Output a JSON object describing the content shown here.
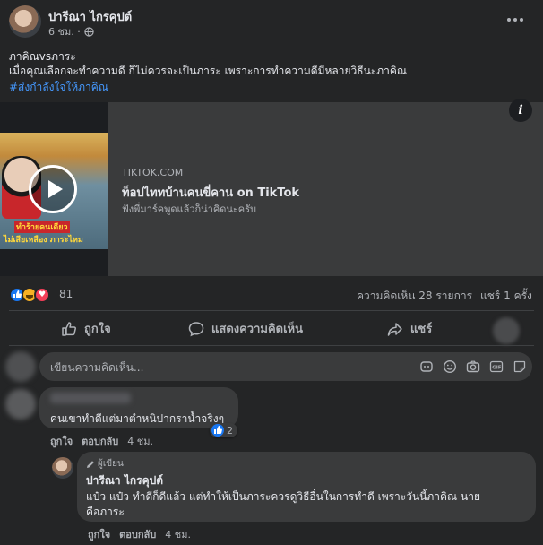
{
  "post": {
    "author": "ปารีณา ไกรคุปต์",
    "time": "6 ชม. ·",
    "text_line1": "ภาคิณvsภาระ",
    "text_line2": "เมื่อคุณเลือกจะทำความดี ก็ไม่ควรจะเป็นภาระ เพราะการทำความดีมีหลายวิธีนะภาคิณ",
    "hashtag": "#ส่งกำลังใจให้ภาคิณ",
    "more_icon": "more-horizontal-icon",
    "privacy_icon": "globe-icon"
  },
  "link_card": {
    "domain": "TIKTOK.COM",
    "title": "ท็อปไททบ้านคนขี่คาน on TikTok",
    "description": "ฟังพี่มาร์คพูดแล้วก็น่าคิดนะครับ",
    "thumb_caption1": "ทำร้ายคนเดียว",
    "thumb_caption2": "ไม่เสียเหลือง ภาระไหม",
    "info_icon": "info-icon",
    "play_icon": "play-icon"
  },
  "reactions": {
    "count": "81",
    "comments": "ความคิดเห็น 28 รายการ",
    "shares": "แชร์ 1 ครั้ง"
  },
  "actions": {
    "like": "ถูกใจ",
    "comment": "แสดงความคิดเห็น",
    "share": "แชร์"
  },
  "composer": {
    "placeholder": "เขียนความคิดเห็น..."
  },
  "comment1": {
    "text": "คนเขาทำดีแต่มาตำหนิปากราน้ำจริงๆ",
    "like": "ถูกใจ",
    "reply": "ตอบกลับ",
    "time": "4 ชม.",
    "like_count": "2"
  },
  "reply1": {
    "badge": "ผู้เขียน",
    "author": "ปารีณา ไกรคุปต์",
    "text_line1": "แป๋ว แป๋ว ทำดีก็ดีแล้ว แต่ทำให้เป็นภาระควรดูวิธีอื่นในการทำดี เพราะวันนี้ภาคิณ นาย",
    "text_line2": "คือภาระ",
    "like": "ถูกใจ",
    "reply": "ตอบกลับ",
    "time": "4 ชม."
  },
  "colors": {
    "background": "#242526",
    "bubble": "#3a3b3c",
    "link": "#4599ff",
    "like_blue": "#1877f2"
  }
}
